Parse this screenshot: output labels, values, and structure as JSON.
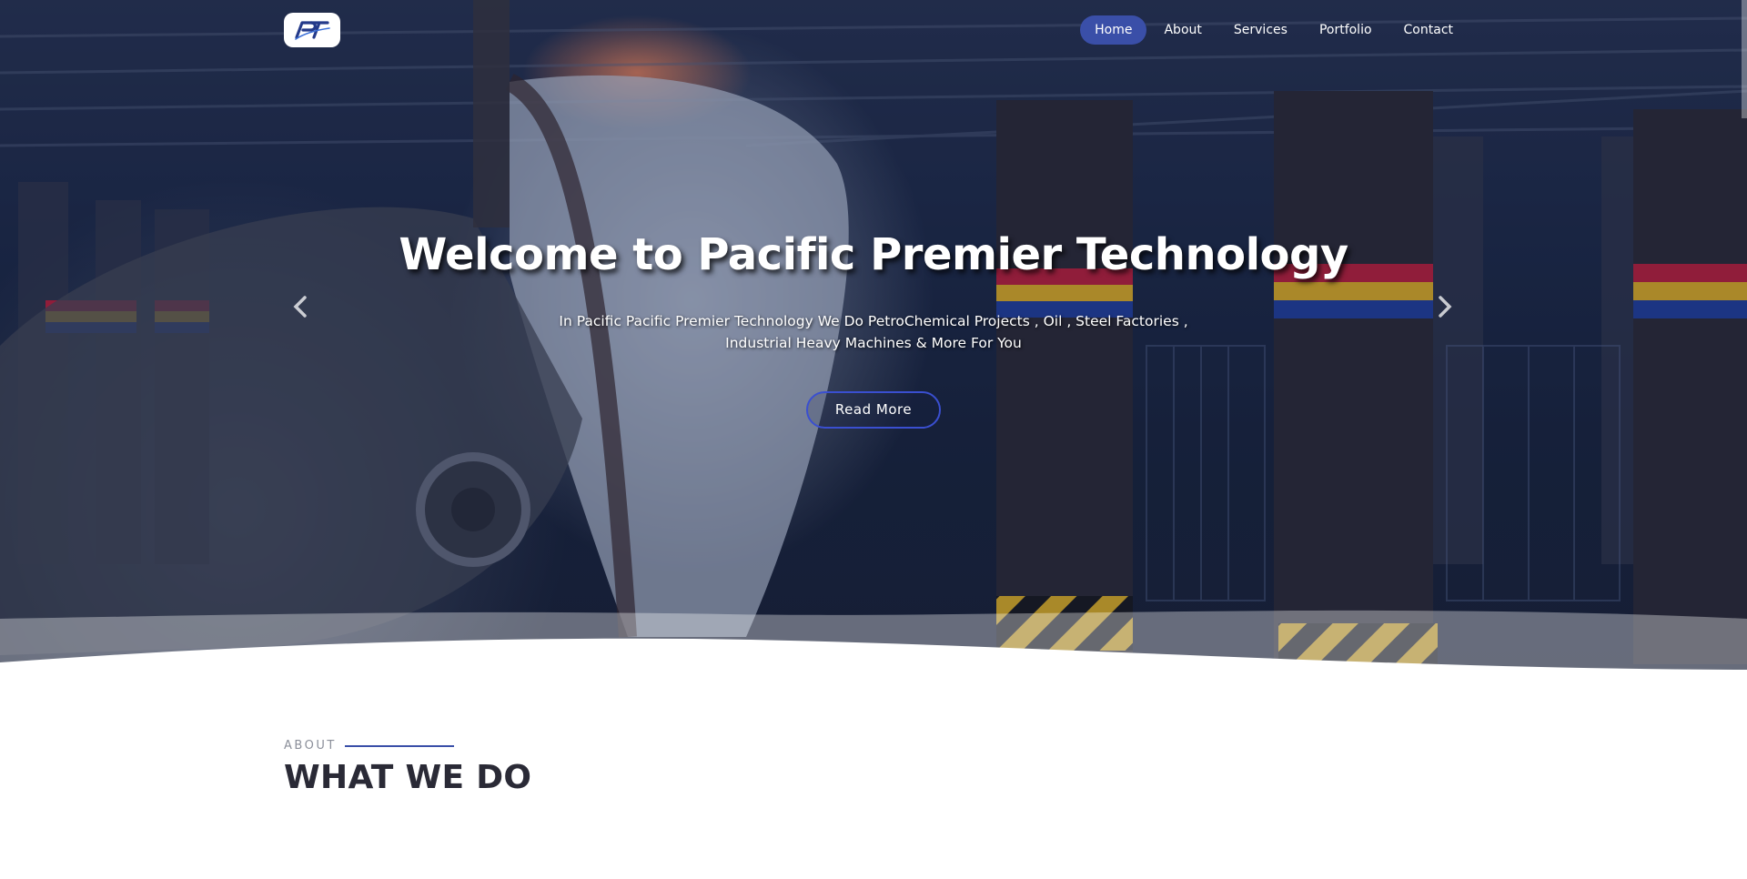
{
  "brand": {
    "logo_text": "PT"
  },
  "nav": {
    "items": [
      {
        "label": "Home",
        "active": true
      },
      {
        "label": "About",
        "active": false
      },
      {
        "label": "Services",
        "active": false
      },
      {
        "label": "Portfolio",
        "active": false
      },
      {
        "label": "Contact",
        "active": false
      }
    ]
  },
  "hero": {
    "title": "Welcome to Pacific Premier Technology",
    "subtitle": "In Pacific Pacific Premier Technology We Do PetroChemical Projects , Oil , Steel Factories , Industrial Heavy Machines & More For You",
    "cta_label": "Read More",
    "prev_icon": "chevron-left-icon",
    "next_icon": "chevron-right-icon"
  },
  "about": {
    "eyebrow": "ABOUT",
    "title": "WHAT WE DO"
  },
  "colors": {
    "accent": "#3a4fa8",
    "button_border": "#3a4fd0",
    "heading": "#2a2a36",
    "eyebrow": "#8b8f9a"
  }
}
